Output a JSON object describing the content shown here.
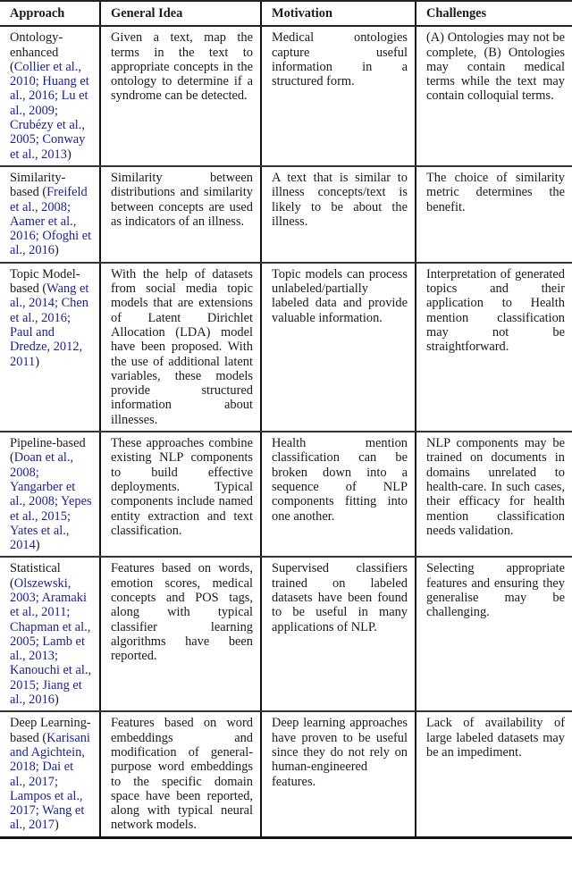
{
  "table": {
    "headers": [
      "Approach",
      "General Idea",
      "Motivation",
      "Challenges"
    ],
    "rows": [
      {
        "approach": {
          "prefix": "Ontology-enhanced (",
          "citations": [
            "Collier et al., 2010;",
            "Huang et al., 2016;",
            "Lu et al., 2009;",
            "Crubézy et al., 2005;",
            "Conway et al., 2013"
          ],
          "suffix": ")"
        },
        "general_idea": "Given a text, map the terms in the text to appropriate concepts in the ontology to determine if a syndrome can be detected.",
        "motivation": "Medical ontologies capture useful information in a structured form.",
        "challenges": "(A) Ontologies may not be complete, (B) Ontologies may contain medical terms while the text may contain colloquial terms."
      },
      {
        "approach": {
          "prefix": "Similarity-based (",
          "citations": [
            "Freifeld et al., 2008;",
            "Aamer et al., 2016;",
            "Ofoghi et al., 2016"
          ],
          "suffix": ")"
        },
        "general_idea": "Similarity between distributions and similarity between concepts are used as indicators of an illness.",
        "motivation": "A text that is similar to illness concepts/text is likely to be about the illness.",
        "challenges": "The choice of similarity metric determines the benefit."
      },
      {
        "approach": {
          "prefix": "Topic Model-based (",
          "citations": [
            "Wang et al., 2014;",
            "Chen et al., 2016;",
            "Paul and Dredze, 2012, 2011"
          ],
          "suffix": ")"
        },
        "general_idea": "With the help of datasets from social media topic models that are extensions of Latent Dirichlet Allocation (LDA) model have been proposed. With the use of additional latent variables, these models provide structured information about illnesses.",
        "motivation": "Topic models can process unlabeled/partially labeled data and provide valuable information.",
        "challenges": "Interpretation of generated topics and their application to Health mention classification may not be straightforward."
      },
      {
        "approach": {
          "prefix": "Pipeline-based (",
          "citations": [
            "Doan et al., 2008;",
            "Yangarber et al., 2008;",
            "Yepes et al., 2015;",
            "Yates et al., 2014"
          ],
          "suffix": ")"
        },
        "general_idea": "These approaches combine existing NLP components to build effective deployments. Typical components include named entity extraction and text classification.",
        "motivation": "Health mention classification can be broken down into a sequence of NLP components fitting into one another.",
        "challenges": "NLP components may be trained on documents in domains unrelated to health-care. In such cases, their efficacy for health mention classification needs validation."
      },
      {
        "approach": {
          "prefix": "Statistical (",
          "citations": [
            "Olszewski, 2003;",
            "Aramaki et al., 2011;",
            "Chapman et al., 2005;",
            "Lamb et al., 2013;",
            "Kanouchi et al., 2015;",
            "Jiang et al., 2016"
          ],
          "suffix": ")"
        },
        "general_idea": "Features based on words, emotion scores, medical concepts and POS tags, along with typical classifier learning algorithms have been reported.",
        "motivation": "Supervised classifiers trained on labeled datasets have been found to be useful in many applications of NLP.",
        "challenges": "Selecting appropriate features and ensuring they generalise may be challenging."
      },
      {
        "approach": {
          "prefix": "Deep Learning-based (",
          "citations": [
            "Karisani and Agichtein, 2018;",
            "Dai et al., 2017;",
            "Lampos et al., 2017;",
            "Wang et al., 2017"
          ],
          "suffix": ")"
        },
        "general_idea": "Features based on word embeddings and modification of general-purpose word embeddings to the specific domain space have been reported, along with typical neural network models.",
        "motivation": "Deep learning approaches have proven to be useful since they do not rely on human-engineered features.",
        "challenges": "Lack of availability of large labeled datasets may be an impediment."
      }
    ]
  }
}
